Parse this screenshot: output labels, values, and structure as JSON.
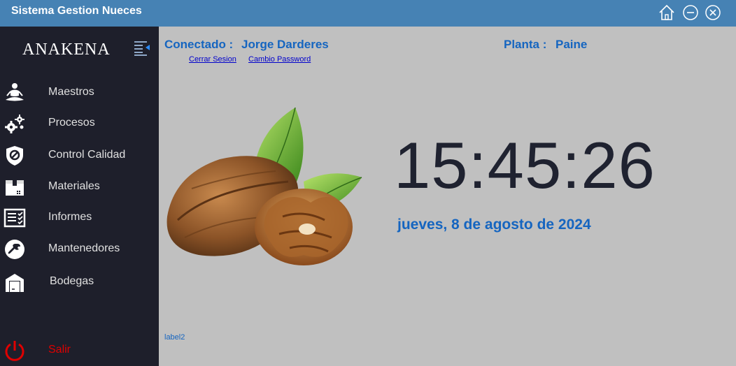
{
  "window": {
    "title": "Sistema Gestion Nueces"
  },
  "sidebar": {
    "brand": "ANAKENA",
    "items": [
      {
        "label": "Maestros",
        "icon": "meditation-person-icon"
      },
      {
        "label": "Procesos",
        "icon": "gears-icon"
      },
      {
        "label": "Control Calidad",
        "icon": "shield-icon"
      },
      {
        "label": "Materiales",
        "icon": "box-icon"
      },
      {
        "label": "Informes",
        "icon": "report-icon"
      },
      {
        "label": "Mantenedores",
        "icon": "wrench-icon"
      },
      {
        "label": "Bodegas",
        "icon": "warehouse-icon"
      }
    ],
    "exit_label": "Salir"
  },
  "header": {
    "connected_label": "Conectado :",
    "user": "Jorge Darderes",
    "plant_label": "Planta :",
    "plant": "Paine",
    "logout_link": "Cerrar Sesion",
    "password_link": "Cambio Password"
  },
  "clock": {
    "time": "15:45:26",
    "date": "jueves, 8 de agosto de 2024"
  },
  "footer": {
    "label": "label2"
  },
  "colors": {
    "titlebar": "#4682b4",
    "sidebar": "#1e1f2b",
    "main_bg": "#c0c0c0",
    "accent_blue": "#1565c0",
    "exit_red": "#e00000"
  }
}
